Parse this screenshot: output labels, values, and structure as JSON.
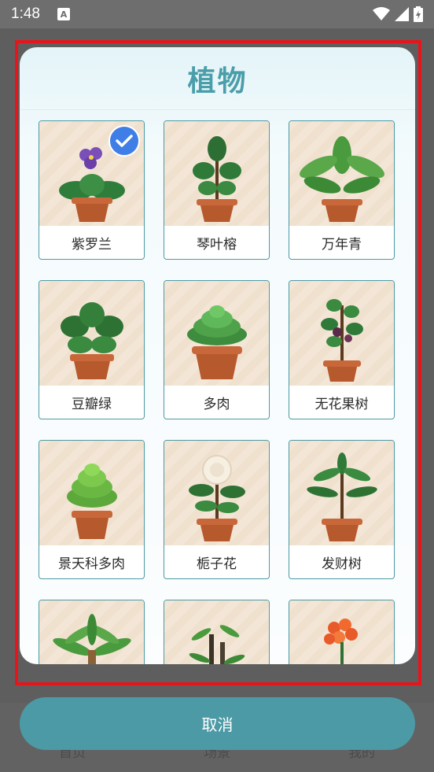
{
  "status_bar": {
    "time": "1:48",
    "notification_icon": "a-icon",
    "icons": [
      "wifi-icon",
      "signal-icon",
      "battery-icon"
    ]
  },
  "background_nav": {
    "items": [
      "首页",
      "场景",
      "我的"
    ]
  },
  "dialog": {
    "title": "植物",
    "plants": [
      {
        "name": "紫罗兰",
        "selected": true
      },
      {
        "name": "琴叶榕",
        "selected": false
      },
      {
        "name": "万年青",
        "selected": false
      },
      {
        "name": "豆瓣绿",
        "selected": false
      },
      {
        "name": "多肉",
        "selected": false
      },
      {
        "name": "无花果树",
        "selected": false
      },
      {
        "name": "景天科多肉",
        "selected": false
      },
      {
        "name": "栀子花",
        "selected": false
      },
      {
        "name": "发财树",
        "selected": false
      },
      {
        "name": "",
        "selected": false
      },
      {
        "name": "",
        "selected": false
      },
      {
        "name": "",
        "selected": false
      }
    ],
    "cancel_label": "取消"
  },
  "colors": {
    "accent": "#4c9aa5",
    "title": "#4a9eaa",
    "check": "#3f7ee6",
    "highlight": "#e8141a"
  }
}
